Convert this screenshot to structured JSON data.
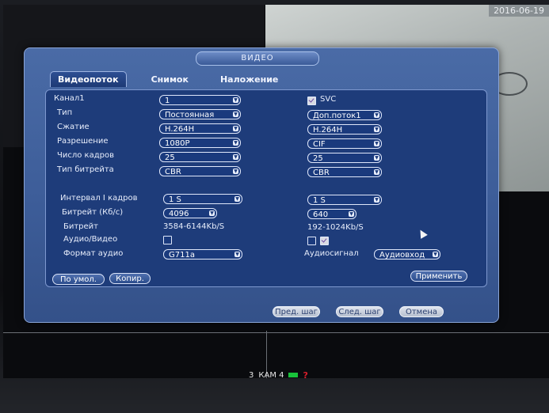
{
  "monitor": {
    "date": "2016-06-19",
    "status": {
      "channel_no": "3",
      "camera": "КАМ 4",
      "alert_symbol": "?"
    }
  },
  "dialog": {
    "title": "ВИДЕО",
    "tabs": [
      {
        "label": "Видеопоток",
        "active": true
      },
      {
        "label": "Снимок",
        "active": false
      },
      {
        "label": "Наложение",
        "active": false
      }
    ],
    "channel": {
      "label": "Канал1",
      "value": "1"
    },
    "svc": {
      "label": "SVC",
      "checked": true
    },
    "rows": [
      {
        "label": "Тип",
        "main": "Постоянная",
        "sub": "Доп.поток1"
      },
      {
        "label": "Сжатие",
        "main": "H.264H",
        "sub": "H.264H"
      },
      {
        "label": "Разрешение",
        "main": "1080P",
        "sub": "CIF"
      },
      {
        "label": "Число кадров",
        "main": "25",
        "sub": "25"
      },
      {
        "label": "Тип битрейта",
        "main": "CBR",
        "sub": "CBR"
      }
    ],
    "iframe": {
      "label": "Интервал I кадров",
      "main": "1 S",
      "sub": "1 S"
    },
    "bitrate": {
      "label": "Битрейт (Кб/с)",
      "main": "4096",
      "sub": "640"
    },
    "bitrate_range": {
      "label": "Битрейт",
      "main": "3584-6144Kb/S",
      "sub": "192-1024Kb/S"
    },
    "av": {
      "label": "Аудио/Видео",
      "main_checked": false,
      "sub_checked": false,
      "sub2_checked": true
    },
    "audio_format": {
      "label": "Формат аудио",
      "main": "G711a"
    },
    "audio_source": {
      "label": "Аудиосигнал",
      "value": "Аудиовход"
    },
    "buttons": {
      "default": "По умол.",
      "copy": "Копир.",
      "apply": "Применить",
      "prev": "Пред. шаг",
      "next": "След. шаг",
      "cancel": "Отмена"
    }
  },
  "colors": {
    "panel": "#3d5d99",
    "inner": "#1e3c7a",
    "accent": "#dfe7fa"
  }
}
